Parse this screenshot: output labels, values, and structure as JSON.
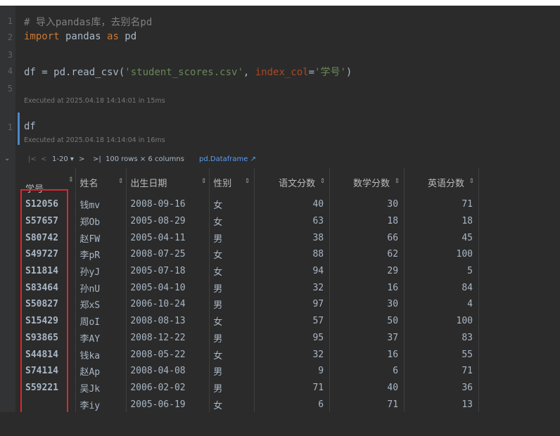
{
  "cell1": {
    "line_numbers": [
      "1",
      "2",
      "3",
      "4",
      "5"
    ],
    "comment": "# 导入pandas库，去别名pd",
    "import_kw": "import",
    "import_mod": " pandas ",
    "as_kw": "as",
    "alias": " pd",
    "read_prefix": "df = pd.read_csv(",
    "read_file": "'student_scores.csv'",
    "read_sep": ", ",
    "read_param": "index_col",
    "read_eq": "=",
    "read_col": "'学号'",
    "read_close": ")",
    "executed": "Executed at 2025.04.18 14:14:01 in 15ms"
  },
  "cell2": {
    "line_number": "1",
    "code": "df",
    "executed": "Executed at 2025.04.18 14:14:04 in 16ms"
  },
  "output_toolbar": {
    "collapse_icon": "chevron-down-icon",
    "first": "|<",
    "prev": "<",
    "page_range": "1-20 ▾",
    "next": ">",
    "last": ">|",
    "summary": "100 rows × 6 columns",
    "link": "pd.Dataframe ↗"
  },
  "table": {
    "headers": [
      "学号",
      "姓名",
      "出生日期",
      "性别",
      "语文分数",
      "数学分数",
      "英语分数"
    ],
    "sort_icon": "⇕",
    "rows": [
      [
        "S12056",
        "钱mv",
        "2008-09-16",
        "女",
        "40",
        "30",
        "71"
      ],
      [
        "S57657",
        "郑Ob",
        "2005-08-29",
        "女",
        "63",
        "18",
        "18"
      ],
      [
        "S80742",
        "赵FW",
        "2005-04-11",
        "男",
        "38",
        "66",
        "45"
      ],
      [
        "S49727",
        "李pR",
        "2008-07-25",
        "女",
        "88",
        "62",
        "100"
      ],
      [
        "S11814",
        "孙yJ",
        "2005-07-18",
        "女",
        "94",
        "29",
        "5"
      ],
      [
        "S83464",
        "孙nU",
        "2005-04-10",
        "男",
        "32",
        "16",
        "84"
      ],
      [
        "S50827",
        "郑xS",
        "2006-10-24",
        "男",
        "97",
        "30",
        "4"
      ],
      [
        "S15429",
        "周oI",
        "2008-08-13",
        "女",
        "57",
        "50",
        "100"
      ],
      [
        "S93865",
        "李AY",
        "2008-12-22",
        "男",
        "95",
        "37",
        "83"
      ],
      [
        "S44814",
        "钱ka",
        "2008-05-22",
        "女",
        "32",
        "16",
        "55"
      ],
      [
        "S74114",
        "赵Ap",
        "2008-04-08",
        "男",
        "9",
        "6",
        "71"
      ],
      [
        "S59221",
        "吴Jk",
        "2006-02-02",
        "男",
        "71",
        "40",
        "36"
      ],
      [
        "",
        "李iy",
        "2005-06-19",
        "女",
        "6",
        "71",
        "13"
      ]
    ]
  },
  "colors": {
    "highlight": "#e0262b",
    "background": "#2b2b2b",
    "keyword": "#cc7832",
    "string": "#6a8759",
    "link": "#589df6"
  }
}
